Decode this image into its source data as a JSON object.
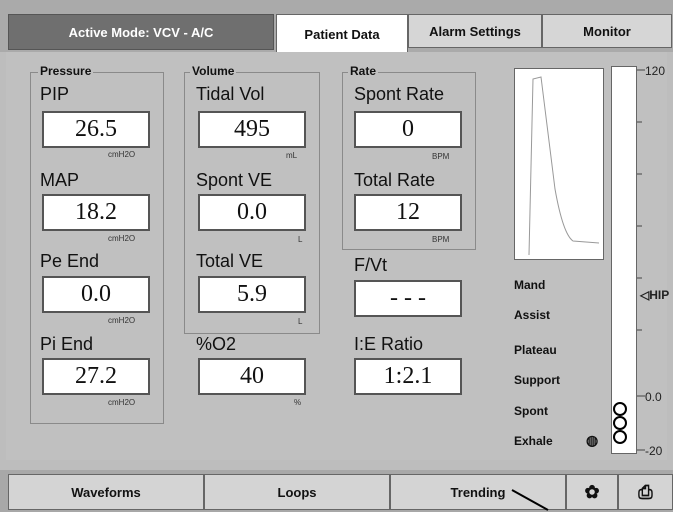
{
  "header": {
    "mode_label": "Active Mode: VCV - A/C",
    "tabs": [
      {
        "label": "Patient Data"
      },
      {
        "label": "Alarm Settings"
      },
      {
        "label": "Monitor"
      }
    ]
  },
  "pressure": {
    "title": "Pressure",
    "pip": {
      "label": "PIP",
      "value": "26.5",
      "unit": "cmH2O"
    },
    "map": {
      "label": "MAP",
      "value": "18.2",
      "unit": "cmH2O"
    },
    "pe_end": {
      "label": "Pe End",
      "value": "0.0",
      "unit": "cmH2O"
    },
    "pi_end": {
      "label": "Pi End",
      "value": "27.2",
      "unit": "cmH2O"
    }
  },
  "volume": {
    "title": "Volume",
    "tidal_vol": {
      "label": "Tidal Vol",
      "value": "495",
      "unit": "mL"
    },
    "spont_ve": {
      "label": "Spont VE",
      "value": "0.0",
      "unit": "L"
    },
    "total_ve": {
      "label": "Total VE",
      "value": "5.9",
      "unit": "L"
    },
    "o2": {
      "label": "%O2",
      "value": "40",
      "unit": "%"
    }
  },
  "rate": {
    "title": "Rate",
    "spont_rate": {
      "label": "Spont Rate",
      "value": "0",
      "unit": "BPM"
    },
    "total_rate": {
      "label": "Total Rate",
      "value": "12",
      "unit": "BPM"
    },
    "fvt": {
      "label": "F/Vt",
      "value": "- - -"
    },
    "ie_ratio": {
      "label": "I:E Ratio",
      "value": "1:2.1"
    }
  },
  "breath_types": [
    "Mand",
    "Assist",
    "Plateau",
    "Support",
    "Spont",
    "Exhale"
  ],
  "scale": {
    "top": "120",
    "mid": "HIP",
    "zero": "0.0",
    "bottom": "-20"
  },
  "footer": {
    "buttons": [
      {
        "label": "Waveforms"
      },
      {
        "label": "Loops"
      },
      {
        "label": "Trending"
      }
    ]
  }
}
